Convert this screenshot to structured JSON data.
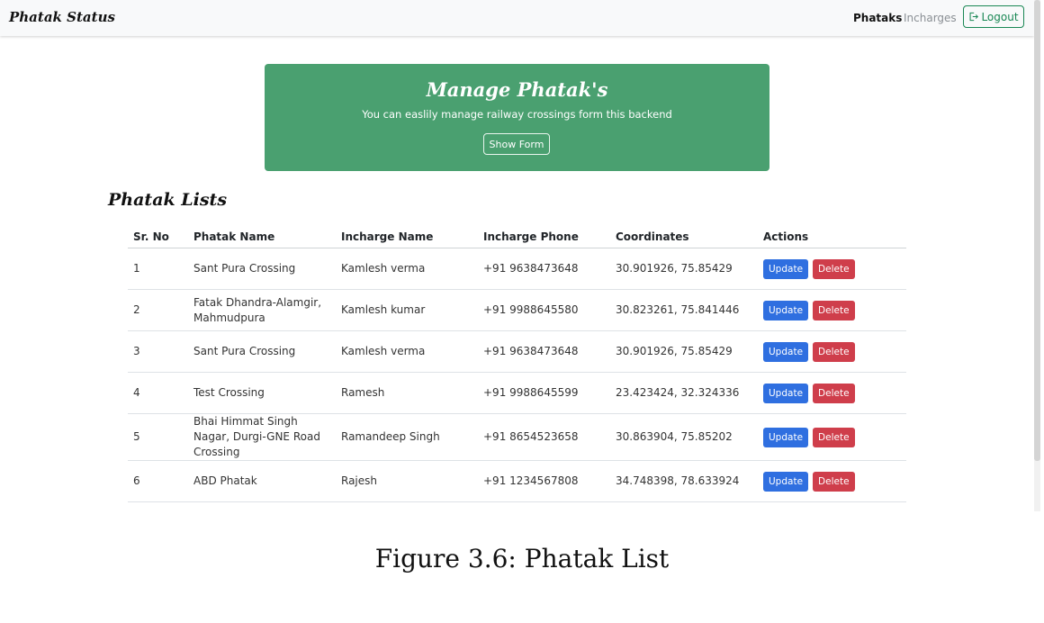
{
  "navbar": {
    "brand": "Phatak Status",
    "links": [
      "Phataks",
      "Incharges"
    ],
    "logout_label": "Logout"
  },
  "hero": {
    "title": "Manage Phatak's",
    "subtitle": "You can easlily manage railway crossings form this backend",
    "button_label": "Show Form"
  },
  "list": {
    "title": "Phatak Lists",
    "columns": [
      "Sr. No",
      "Phatak Name",
      "Incharge Name",
      "Incharge Phone",
      "Coordinates",
      "Actions"
    ],
    "rows": [
      {
        "sr": "1",
        "name": "Sant Pura Crossing",
        "incharge": "Kamlesh verma",
        "phone": "+91 9638473648",
        "coords": "30.901926, 75.85429"
      },
      {
        "sr": "2",
        "name": "Fatak Dhandra-Alamgir, Mahmudpura",
        "incharge": "Kamlesh kumar",
        "phone": "+91 9988645580",
        "coords": "30.823261, 75.841446"
      },
      {
        "sr": "3",
        "name": "Sant Pura Crossing",
        "incharge": "Kamlesh verma",
        "phone": "+91 9638473648",
        "coords": "30.901926, 75.85429"
      },
      {
        "sr": "4",
        "name": "Test Crossing",
        "incharge": "Ramesh",
        "phone": "+91 9988645599",
        "coords": "23.423424, 32.324336"
      },
      {
        "sr": "5",
        "name": "Bhai Himmat Singh Nagar, Durgi-GNE Road Crossing",
        "incharge": "Ramandeep Singh",
        "phone": "+91 8654523658",
        "coords": "30.863904, 75.85202"
      },
      {
        "sr": "6",
        "name": "ABD Phatak",
        "incharge": "Rajesh",
        "phone": "+91 1234567808",
        "coords": "34.748398, 78.633924"
      }
    ],
    "update_label": "Update",
    "delete_label": "Delete"
  },
  "caption": "Figure 3.6: Phatak List",
  "colors": {
    "hero_bg": "#4aa070",
    "update": "#2f6fe0",
    "delete": "#cf3e4b",
    "logout": "#198754"
  },
  "icons": {
    "logout": "logout-icon"
  }
}
